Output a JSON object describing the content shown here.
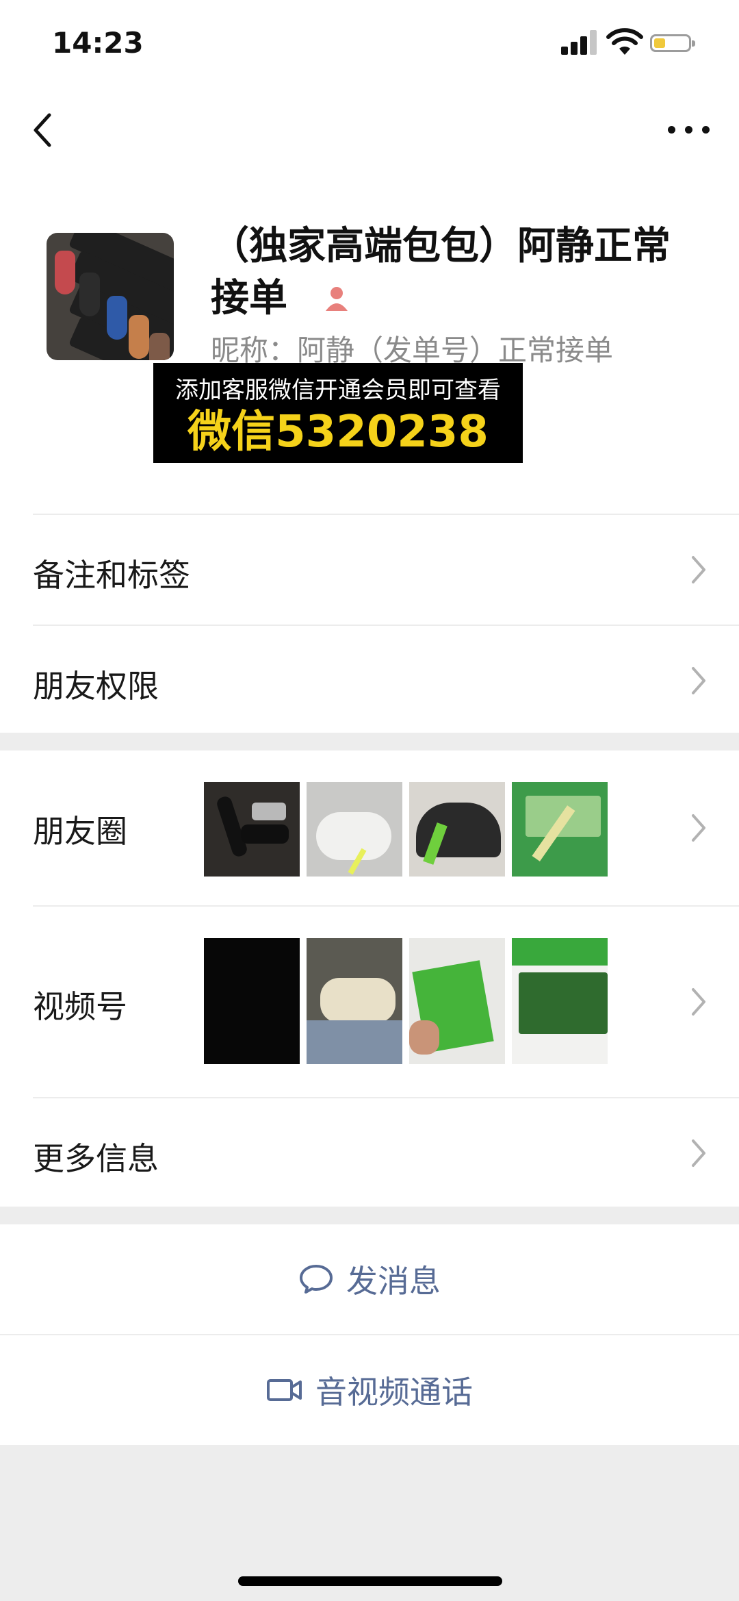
{
  "status_bar": {
    "time": "14:23"
  },
  "profile": {
    "display_name": "（独家高端包包）阿静正常接单",
    "nickname": "昵称：阿静（发单号）正常接单"
  },
  "promo": {
    "line1": "添加客服微信开通会员即可查看",
    "line2": "微信5320238"
  },
  "menu": {
    "remarks_tags": "备注和标签",
    "friend_permissions": "朋友权限",
    "moments": "朋友圈",
    "channels": "视频号",
    "more_info": "更多信息"
  },
  "actions": {
    "send_message": "发消息",
    "av_call": "音视频通话"
  },
  "icons": {
    "back": "chevron-left-icon",
    "more": "ellipsis-icon",
    "chevron": "chevron-right-icon",
    "message": "chat-bubble-icon",
    "video": "video-camera-icon"
  },
  "colors": {
    "link_blue": "#576b95",
    "promo_yellow": "#f5d21a",
    "background": "#ededed"
  }
}
